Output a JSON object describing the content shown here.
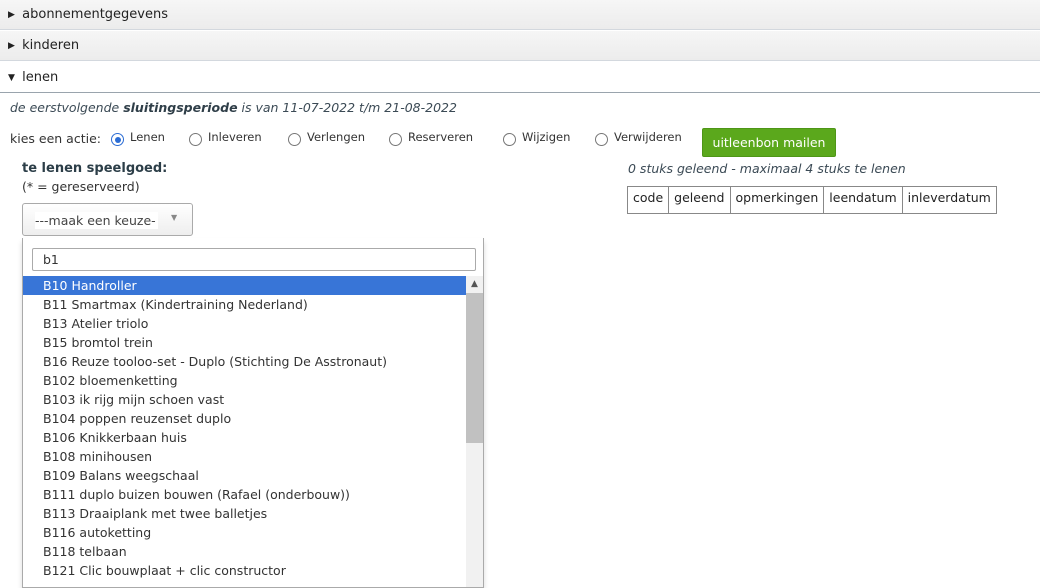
{
  "accordion": [
    {
      "label": "abonnementgegevens",
      "state": "collapsed"
    },
    {
      "label": "kinderen",
      "state": "collapsed"
    },
    {
      "label": "lenen",
      "state": "open"
    }
  ],
  "info": {
    "prefix": "de eerstvolgende ",
    "bold": "sluitingsperiode",
    "suffix": " is van 11-07-2022 t/m 21-08-2022"
  },
  "actions": {
    "label": "kies een actie:",
    "options": [
      {
        "label": "Lenen",
        "checked": true
      },
      {
        "label": "Inleveren",
        "checked": false
      },
      {
        "label": "Verlengen",
        "checked": false
      },
      {
        "label": "Reserveren",
        "checked": false
      },
      {
        "label": "Wijzigen",
        "checked": false
      },
      {
        "label": "Verwijderen",
        "checked": false
      }
    ],
    "mail_button": "uitleenbon mailen"
  },
  "lend": {
    "title": "te lenen speelgoed:",
    "subtitle": "(* = gereserveerd)",
    "select_placeholder": "---maak een keuze-",
    "search_value": "b1",
    "options": [
      "B10 Handroller",
      "B11 Smartmax (Kindertraining Nederland)",
      "B13 Atelier triolo",
      "B15 bromtol trein",
      "B16 Reuze tooloo-set - Duplo (Stichting De Asstronaut)",
      "B102 bloemenketting",
      "B103 ik rijg mijn schoen vast",
      "B104 poppen reuzenset duplo",
      "B106 Knikkerbaan huis",
      "B108 minihousen",
      "B109 Balans weegschaal",
      "B111 duplo buizen bouwen (Rafael (onderbouw))",
      "B113 Draaiplank met twee balletjes",
      "B116 autoketting",
      "B118 telbaan",
      "B121 Clic bouwplaat + clic constructor"
    ],
    "active_index": 0
  },
  "lent": {
    "summary": "0 stuks geleend - maximaal 4 stuks te lenen",
    "columns": [
      "code",
      "geleend",
      "opmerkingen",
      "leendatum",
      "inleverdatum"
    ]
  },
  "icons": {
    "caret_right": "caret-right-icon",
    "caret_down": "caret-down-icon",
    "select_arrow": "chevron-down-icon",
    "scroll_up": "chevron-up-icon"
  },
  "colors": {
    "button_green": "#5ba81c",
    "active_option": "#3875d7",
    "radio_checked": "#2b6cd4"
  }
}
